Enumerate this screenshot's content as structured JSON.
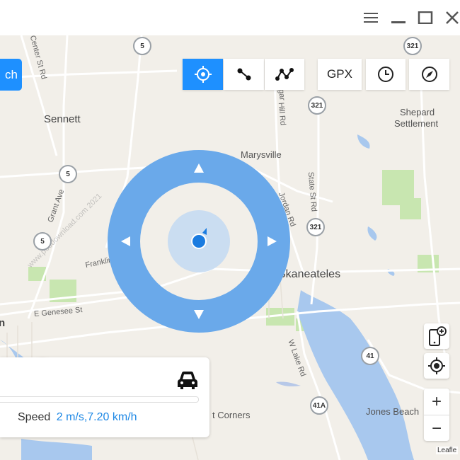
{
  "window": {
    "controls": [
      "menu-icon",
      "minimize-icon",
      "maximize-icon",
      "close-icon"
    ]
  },
  "toolbar": {
    "search_label": "ch",
    "gpx_label": "GPX",
    "buttons": [
      "crosshair-icon",
      "two-spot-icon",
      "multi-spot-icon",
      "gpx",
      "history-icon",
      "compass-icon"
    ],
    "active_color": "#1e90ff"
  },
  "map": {
    "towns": {
      "sennett": "Sennett",
      "shepard": "Shepard",
      "settlement": "Settlement",
      "marysville": "Marysville",
      "skaneateles": "Skaneateles",
      "jones_beach": "Jones Beach",
      "corners": "t Corners",
      "left_edge": "n"
    },
    "roads": {
      "franklin": "Franklin St Rd",
      "genesee": "E Genesee St",
      "grant": "Grant Ave",
      "jordan": "Jordan Rd",
      "state": "State St Rd",
      "lake": "W Lake Rd",
      "center": "Center St Rd",
      "hill": "Hill Rd",
      "gar": "gar"
    },
    "shields": {
      "r5a": "5",
      "r5b": "5",
      "r5c": "5",
      "r321a": "321",
      "r321b": "321",
      "r321c": "321",
      "r41": "41",
      "r41a": "41A"
    },
    "watermark": "www.p30download.com 2021",
    "attribution": "Leafle",
    "water_color": "#a8c8ee",
    "park_color": "#c8e6b0"
  },
  "joystick": {
    "ring_color": "#6aa9ea",
    "center_color": "#1a7be0"
  },
  "panel": {
    "speed_label": "Speed",
    "speed_value": "2 m/s,7.20 km/h",
    "mode_icon": "car-icon"
  },
  "side": {
    "buttons": [
      "add-device-icon",
      "locate-icon"
    ],
    "zoom_in": "+",
    "zoom_out": "−"
  }
}
